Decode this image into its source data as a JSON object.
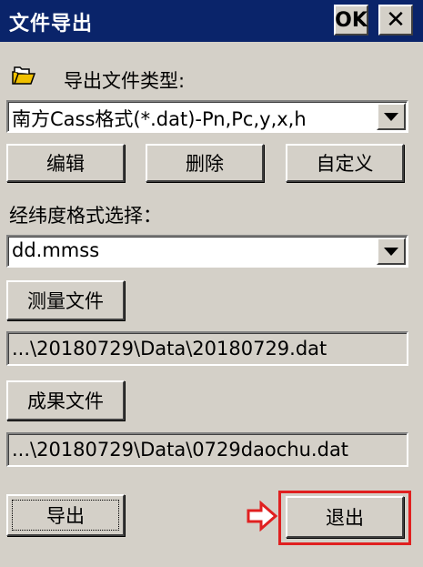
{
  "window": {
    "title": "文件导出",
    "ok_label": "OK",
    "close_label": "✕"
  },
  "export_type": {
    "label": "导出文件类型:",
    "selected": "南方Cass格式(*.dat)-Pn,Pc,y,x,h",
    "icon": "folder-icon"
  },
  "type_buttons": {
    "edit": "编辑",
    "delete": "删除",
    "custom": "自定义"
  },
  "latlon_format": {
    "label": "经纬度格式选择：",
    "selected": "dd.mmss"
  },
  "survey_file": {
    "button_label": "测量文件",
    "path": "...\\20180729\\Data\\20180729.dat"
  },
  "result_file": {
    "button_label": "成果文件",
    "path": "...\\20180729\\Data\\0729daochu.dat"
  },
  "actions": {
    "export": "导出",
    "exit": "退出"
  },
  "colors": {
    "titlebar": "#0a246a",
    "highlight": "#e02020",
    "face": "#d4d0c8"
  }
}
